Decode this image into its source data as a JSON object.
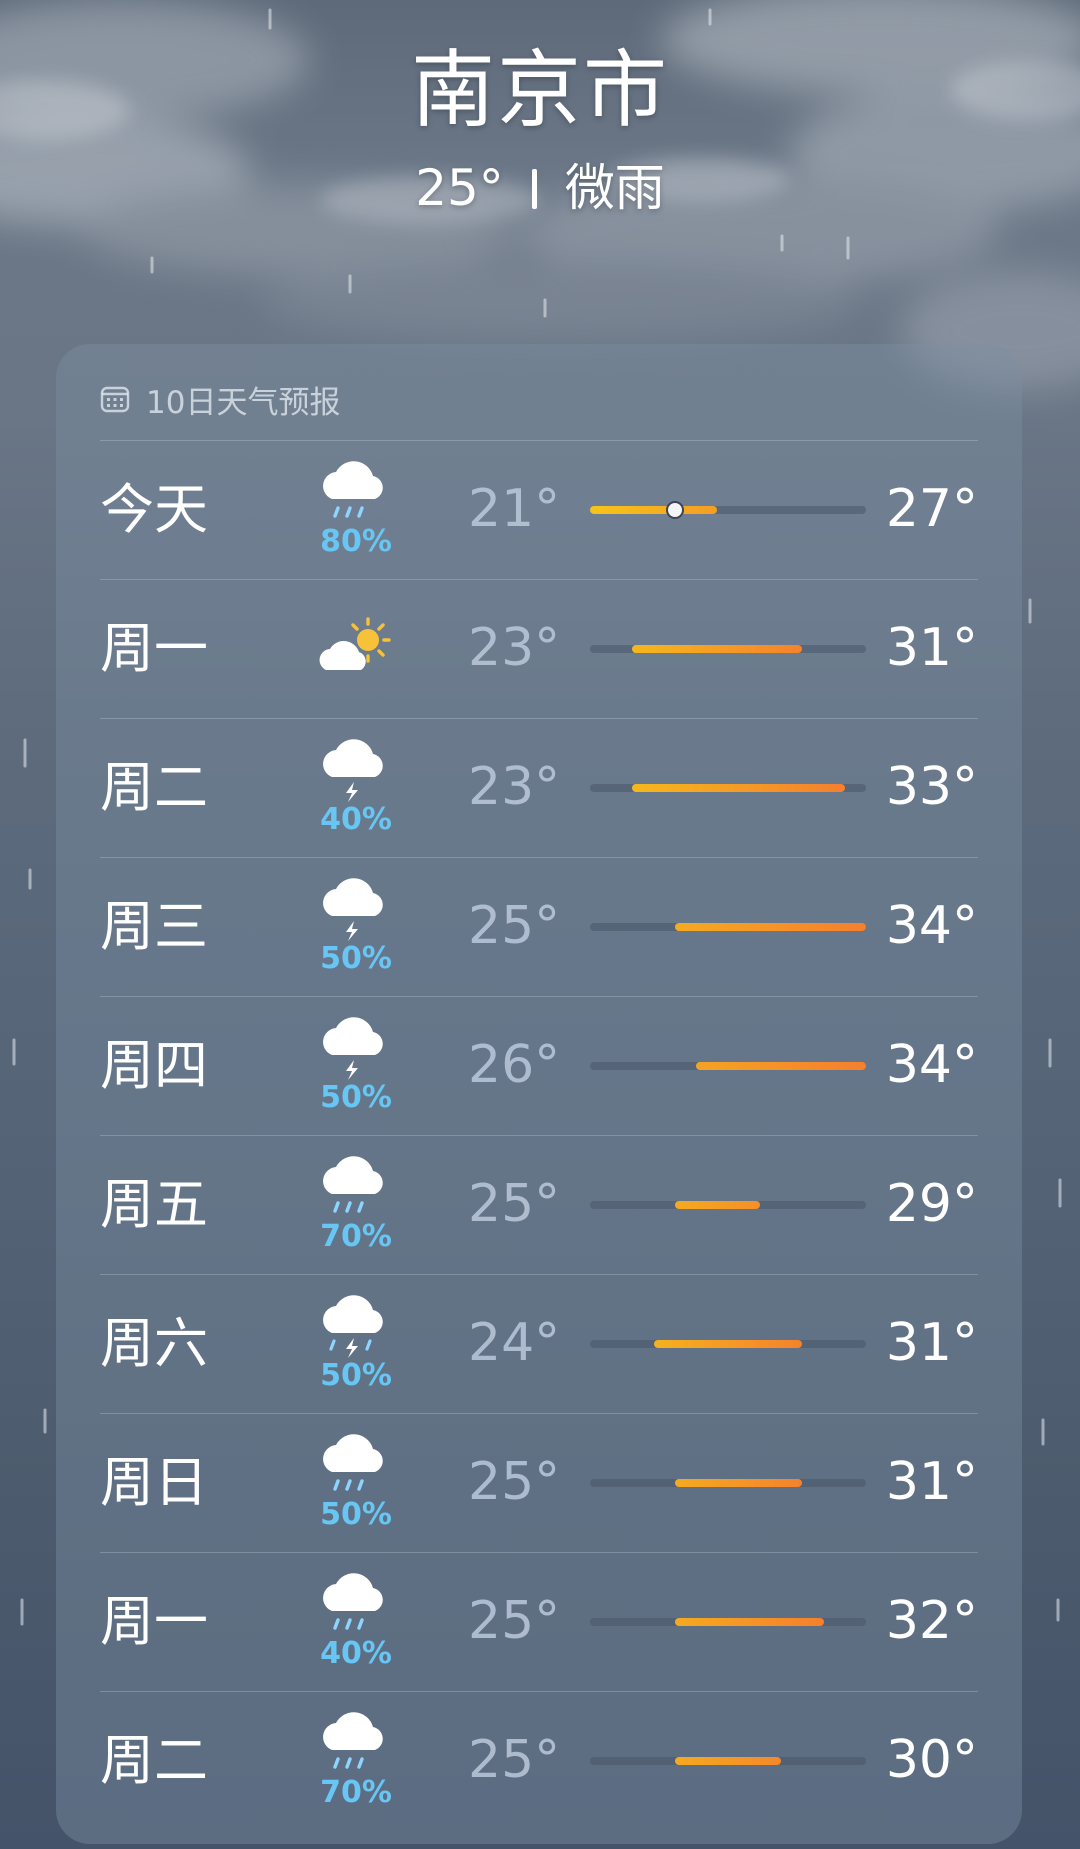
{
  "header": {
    "city": "南京市",
    "current_temp": "25°",
    "condition": "微雨"
  },
  "forecast": {
    "title": "10日天气预报",
    "range_min": 21,
    "range_max": 34,
    "current_temp_value": 25,
    "days": [
      {
        "label": "今天",
        "icon": "rain-cloud-icon",
        "precip": "80%",
        "low": "21°",
        "high": "27°",
        "low_v": 21,
        "high_v": 27,
        "current": true
      },
      {
        "label": "周一",
        "icon": "partly-sunny-icon",
        "precip": "",
        "low": "23°",
        "high": "31°",
        "low_v": 23,
        "high_v": 31
      },
      {
        "label": "周二",
        "icon": "thunder-cloud-icon",
        "precip": "40%",
        "low": "23°",
        "high": "33°",
        "low_v": 23,
        "high_v": 33
      },
      {
        "label": "周三",
        "icon": "thunder-cloud-icon",
        "precip": "50%",
        "low": "25°",
        "high": "34°",
        "low_v": 25,
        "high_v": 34
      },
      {
        "label": "周四",
        "icon": "thunder-cloud-icon",
        "precip": "50%",
        "low": "26°",
        "high": "34°",
        "low_v": 26,
        "high_v": 34
      },
      {
        "label": "周五",
        "icon": "rain-cloud-icon",
        "precip": "70%",
        "low": "25°",
        "high": "29°",
        "low_v": 25,
        "high_v": 29
      },
      {
        "label": "周六",
        "icon": "thunderstorm-rain-icon",
        "precip": "50%",
        "low": "24°",
        "high": "31°",
        "low_v": 24,
        "high_v": 31
      },
      {
        "label": "周日",
        "icon": "rain-cloud-icon",
        "precip": "50%",
        "low": "25°",
        "high": "31°",
        "low_v": 25,
        "high_v": 31
      },
      {
        "label": "周一",
        "icon": "rain-cloud-icon",
        "precip": "40%",
        "low": "25°",
        "high": "32°",
        "low_v": 25,
        "high_v": 32
      },
      {
        "label": "周二",
        "icon": "rain-cloud-icon",
        "precip": "70%",
        "low": "25°",
        "high": "30°",
        "low_v": 25,
        "high_v": 30
      }
    ]
  },
  "colors": {
    "precip_blue": "#67c6f3",
    "bar_cool": "#f5c518",
    "bar_warm": "#f57f2e"
  }
}
